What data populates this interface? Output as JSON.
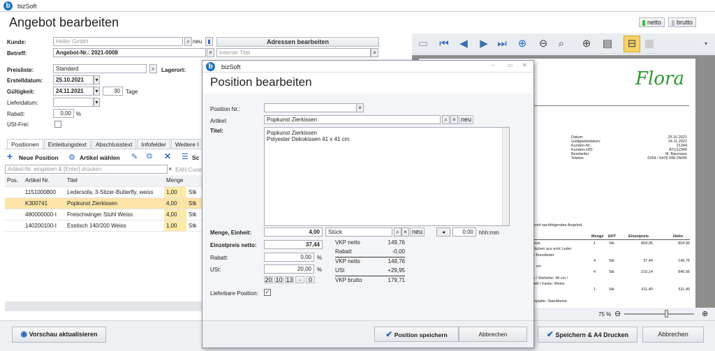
{
  "app": {
    "title": "bizSoft"
  },
  "header": {
    "title": "Angebot bearbeiten",
    "netto": "netto",
    "brutto": "brutto"
  },
  "form": {
    "kunde_label": "Kunde:",
    "kunde_placeholder": "Heller GmbH",
    "neu": "neu",
    "betreff_label": "Betreff:",
    "betreff_value": "Angebot-Nr.: 2021-0008",
    "adressen_btn": "Adressen bearbeiten",
    "intern_placeholder": "interner Titel",
    "preisliste_label": "Preisliste:",
    "preisliste_value": "Standard",
    "lagerort_label": "Lagerort:",
    "erstell_label": "Erstelldatum:",
    "erstell_value": "25.10.2021",
    "gueltig_label": "Gültigkeit:",
    "gueltig_value": "24.11.2021",
    "tage_value": "30",
    "tage_label": "Tage",
    "liefer_label": "Lieferdatum:",
    "rabatt_label": "Rabatt:",
    "rabatt_value": "0,00",
    "percent": "%",
    "ust_frei_label": "USt-Frei:"
  },
  "tabs": [
    "Positionen",
    "Einleitungstext",
    "Abschlusstext",
    "Infofelder",
    "Weitere I"
  ],
  "toolbar": {
    "neue_position": "Neue Position",
    "artikel_waehlen": "Artikel wählen",
    "sc": "Sc"
  },
  "grid": {
    "search_placeholder": "Artikel-Nr. eingeben & [Enter] drücken",
    "ean_placeholder": "EAN Code",
    "headers": [
      "Pos.",
      "Artikel Nr.",
      "Titel",
      "Menge",
      ""
    ],
    "rows": [
      {
        "nr": "1151000800",
        "titel": "Ledersofa, 3-Sitzer-Butterfly, weiss",
        "menge": "1,00",
        "einheit": "Stk"
      },
      {
        "nr": "K300741",
        "titel": "Popkunst Zierkissen",
        "menge": "4,00",
        "einheit": "Stk"
      },
      {
        "nr": "480000000-I",
        "titel": "Freischwinger Stuhl Weiss",
        "menge": "4,00",
        "einheit": "Stk"
      },
      {
        "nr": "140200100-I",
        "titel": "Esstisch 140/200 Weiss",
        "menge": "1,00",
        "einheit": "Stk"
      }
    ]
  },
  "bottom": {
    "vorschau": "Vorschau aktualisieren",
    "speichern_drucken": "Speichern & A4 Drucken",
    "abbrechen": "Abbrechen",
    "zoom": "75 %"
  },
  "preview": {
    "logo": "Flora",
    "info": [
      [
        "Datum:",
        "25.10.2021"
      ],
      [
        "Gültigkeitsdatum:",
        "24.11.2021"
      ],
      [
        "Kunden-Nr.:",
        "21344"
      ],
      [
        "Kunden-UID:",
        "ATU12345"
      ],
      [
        "Bearbeiter",
        "M. Baumann"
      ],
      [
        "Telefon",
        "0254 / 5478 998 DW45"
      ]
    ],
    "intro": "ermit nachfolgendes Angebot.",
    "table_headers": [
      "Menge",
      "EHT",
      "Einzelpreis",
      "Netto"
    ],
    "lines": [
      {
        "text": "weiss",
        "menge": "1",
        "eht": "Stk",
        "preis": "804,95",
        "netto": "804,95"
      },
      {
        "text": "zflächen aus echt Leder",
        "menge": "",
        "eht": "",
        "preis": "",
        "netto": ""
      },
      {
        "text": "us Kunstleder",
        "menge": "",
        "eht": "",
        "preis": "",
        "netto": ""
      },
      {
        "text": "",
        "menge": "4",
        "eht": "Stk",
        "preis": "37,44",
        "netto": "149,76"
      },
      {
        "text": "41 cm",
        "menge": "",
        "eht": "",
        "preis": "",
        "netto": ""
      },
      {
        "text": "",
        "menge": "4",
        "eht": "Stk",
        "preis": "210,14",
        "netto": "840,56"
      },
      {
        "text": "on / Sitzhöhe: 48 cm /",
        "menge": "",
        "eht": "",
        "preis": "",
        "netto": ""
      },
      {
        "text": "rstell / Farbe: Weiss",
        "menge": "",
        "eht": "",
        "preis": "",
        "netto": ""
      },
      {
        "text": "",
        "menge": "1",
        "eht": "Stk",
        "preis": "611,40",
        "netto": "611,40"
      },
      {
        "text": "",
        "menge": "",
        "eht": "",
        "preis": "",
        "netto": ""
      },
      {
        "text": "serplatte, Standbeine",
        "menge": "",
        "eht": "",
        "preis": "",
        "netto": ""
      }
    ]
  },
  "dialog": {
    "app_title": "bizSoft",
    "title": "Position bearbeiten",
    "posnr_label": "Position Nr.:",
    "artikel_label": "Artikel:",
    "artikel_value": "Popkunst Zierkissen",
    "neu": "neu",
    "titel_label": "Titel:",
    "titel_line1": "Popkunst Zierkissen",
    "titel_line2": "Polyester Dekokissen 41 x 41 cm",
    "menge_label": "Menge, Einheit:",
    "menge_value": "4,00",
    "einheit_value": "Stück",
    "time_value": "0:00",
    "time_unit": "hhh:mm",
    "einzelpreis_label": "Einzelpreis netto:",
    "einzelpreis_value": "37,44",
    "rabatt_label": "Rabatt:",
    "rabatt_value": "0,00",
    "ust_label": "USt:",
    "ust_value": "20,00",
    "percent": "%",
    "ust_chips": [
      "20",
      "10",
      "13",
      "-",
      "0"
    ],
    "lieferbar_label": "Lieferbare Position:",
    "summary": [
      [
        "VKP netto",
        "149,76"
      ],
      [
        "Rabatt",
        "-0,00"
      ],
      [
        "VKP netto",
        "149,76"
      ],
      [
        "USt",
        "+29,95"
      ],
      [
        "VKP brutto",
        "179,71"
      ]
    ],
    "save_btn": "Position speichern",
    "cancel_btn": "Abbrechen"
  }
}
